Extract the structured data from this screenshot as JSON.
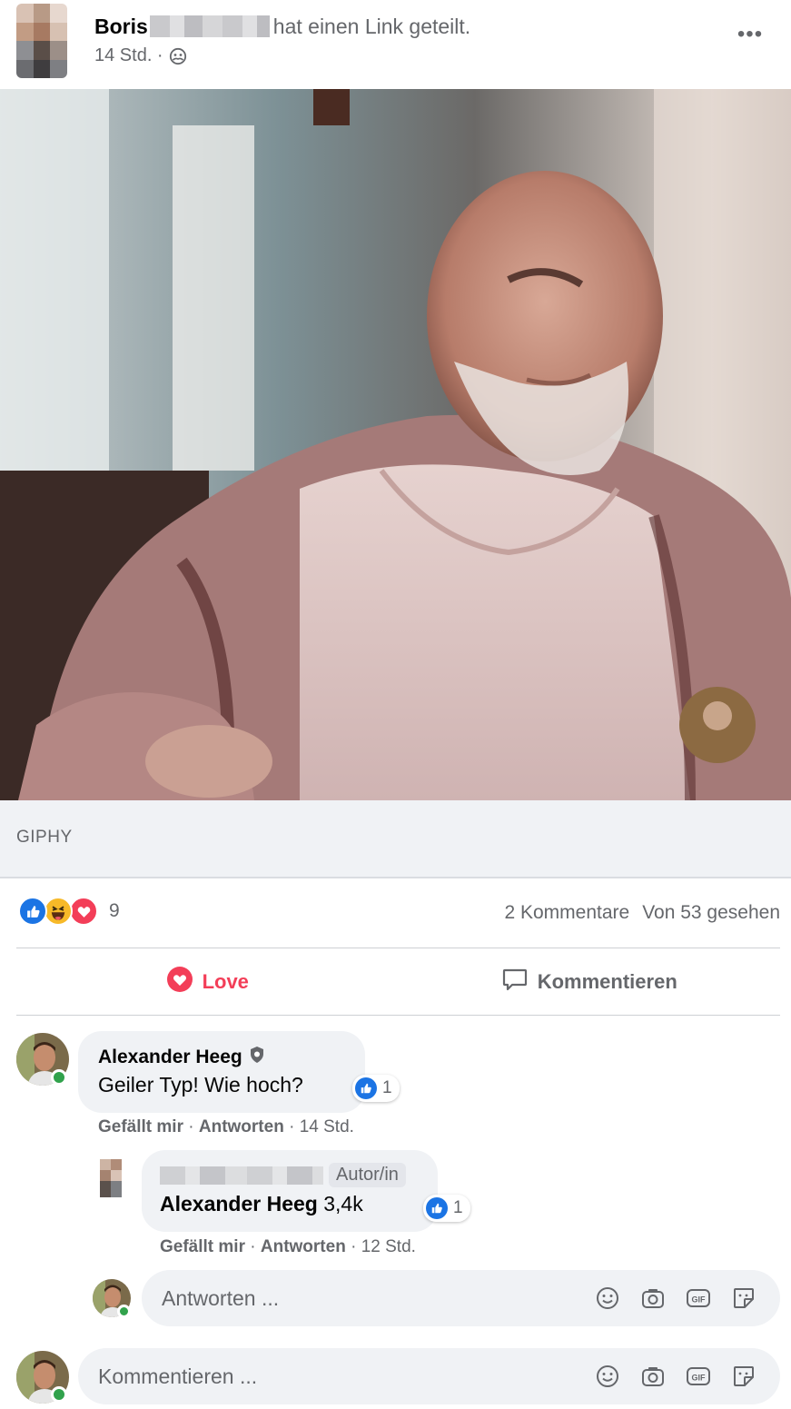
{
  "post": {
    "author_name": "Boris",
    "action_text": "hat einen Link geteilt.",
    "time": "14 Std. ·",
    "audience_icon": "friends-icon",
    "more_icon": "more-icon"
  },
  "media": {
    "source": "GIPHY"
  },
  "stats": {
    "reaction_icons": [
      "like-icon",
      "haha-icon",
      "love-icon"
    ],
    "reaction_count": "9",
    "comments": "2 Kommentare",
    "seen": "Von 53 gesehen"
  },
  "actions": {
    "love_label": "Love",
    "comment_label": "Kommentieren"
  },
  "comments": [
    {
      "name": "Alexander Heeg",
      "text": "Geiler Typ! Wie hoch?",
      "likes": "1",
      "like_label": "Gefällt mir",
      "reply_label": "Antworten",
      "time": "14 Std."
    }
  ],
  "reply": {
    "author_tag": "Autor/in",
    "mention": "Alexander Heeg",
    "text": "3,4k",
    "likes": "1",
    "like_label": "Gefällt mir",
    "reply_label": "Antworten",
    "time": "12 Std."
  },
  "reply_input": {
    "placeholder": "Antworten ..."
  },
  "comment_input": {
    "placeholder": "Kommentieren ..."
  },
  "colors": {
    "love": "#f33e58",
    "like": "#1b74e4",
    "online": "#31a24c",
    "secondary_text": "#65676b"
  }
}
